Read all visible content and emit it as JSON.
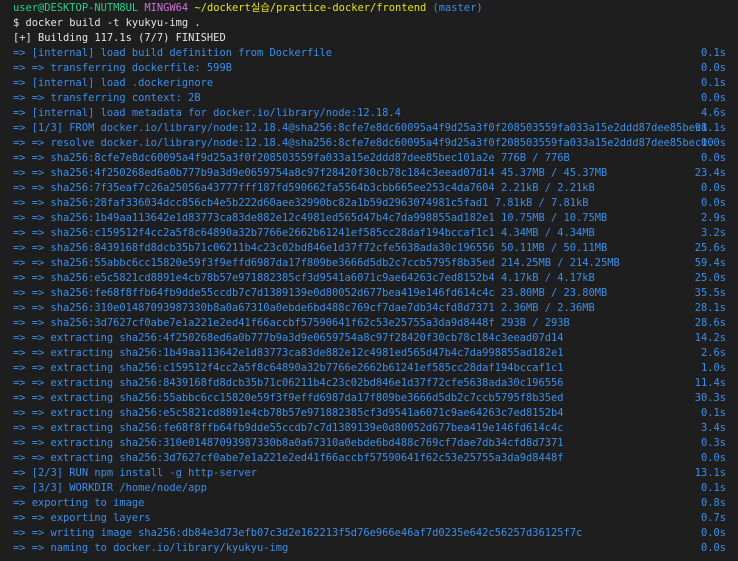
{
  "prompt": {
    "user_host": "user@DESKTOP-NUTM8UL",
    "shell": "MINGW64",
    "path": "~/dockert실습/practice-docker/frontend",
    "branch": "(master)"
  },
  "command": "$ docker build -t kyukyu-img .",
  "status": "[+] Building 117.1s (7/7) FINISHED",
  "steps": [
    {
      "text": "=> [internal] load build definition from Dockerfile",
      "time": "0.1s"
    },
    {
      "text": "=> => transferring dockerfile: 599B",
      "time": "0.0s"
    },
    {
      "text": "=> [internal] load .dockerignore",
      "time": "0.1s"
    },
    {
      "text": "=> => transferring context: 2B",
      "time": "0.0s"
    },
    {
      "text": "=> [internal] load metadata for docker.io/library/node:12.18.4",
      "time": "4.6s"
    },
    {
      "text": "=> [1/3] FROM docker.io/library/node:12.18.4@sha256:8cfe7e8dc60095a4f9d25a3f0f208503559fa033a15e2ddd87dee85bec1",
      "time": "98.1s"
    },
    {
      "text": "=> => resolve docker.io/library/node:12.18.4@sha256:8cfe7e8dc60095a4f9d25a3f0f208503559fa033a15e2ddd87dee85bec10",
      "time": "0.0s"
    },
    {
      "text": "=> => sha256:8cfe7e8dc60095a4f9d25a3f0f208503559fa033a15e2ddd87dee85bec101a2e 776B / 776B",
      "time": "0.0s"
    },
    {
      "text": "=> => sha256:4f250268ed6a0b777b9a3d9e0659754a8c97f28420f30cb78c184c3eead07d14 45.37MB / 45.37MB",
      "time": "23.4s"
    },
    {
      "text": "=> => sha256:7f35eaf7c26a25056a43777fff187fd590662fa5564b3cbb665ee253c4da7604 2.21kB / 2.21kB",
      "time": "0.0s"
    },
    {
      "text": "=> => sha256:28faf336034dcc856cb4e5b222d60aee32990bc82a1b59d2963074981c5fad1 7.81kB / 7.81kB",
      "time": "0.0s"
    },
    {
      "text": "=> => sha256:1b49aa113642e1d83773ca83de882e12c4981ed565d47b4c7da998855ad182e1 10.75MB / 10.75MB",
      "time": "2.9s"
    },
    {
      "text": "=> => sha256:c159512f4cc2a5f8c64890a32b7766e2662b61241ef585cc28daf194bccaf1c1 4.34MB / 4.34MB",
      "time": "3.2s"
    },
    {
      "text": "=> => sha256:8439168fd8dcb35b71c06211b4c23c02bd846e1d37f72cfe5638ada30c196556 50.11MB / 50.11MB",
      "time": "25.6s"
    },
    {
      "text": "=> => sha256:55abbc6cc15820e59f3f9effd6987da17f809be3666d5db2c7ccb5795f8b35ed 214.25MB / 214.25MB",
      "time": "59.4s"
    },
    {
      "text": "=> => sha256:e5c5821cd8891e4cb78b57e971882385cf3d9541a6071c9ae64263c7ed8152b4 4.17kB / 4.17kB",
      "time": "25.0s"
    },
    {
      "text": "=> => sha256:fe68f8ffb64fb9dde55ccdb7c7d1389139e0d80052d677bea419e146fd614c4c 23.80MB / 23.80MB",
      "time": "35.5s"
    },
    {
      "text": "=> => sha256:310e01487093987330b8a0a67310a0ebde6bd488c769cf7dae7db34cfd8d7371 2.36MB / 2.36MB",
      "time": "28.1s"
    },
    {
      "text": "=> => sha256:3d7627cf0abe7e1a221e2ed41f66accbf57590641f62c53e25755a3da9d8448f 293B / 293B",
      "time": "28.6s"
    },
    {
      "text": "=> => extracting sha256:4f250268ed6a0b777b9a3d9e0659754a8c97f28420f30cb78c184c3eead07d14",
      "time": "14.2s"
    },
    {
      "text": "=> => extracting sha256:1b49aa113642e1d83773ca83de882e12c4981ed565d47b4c7da998855ad182e1",
      "time": "2.6s"
    },
    {
      "text": "=> => extracting sha256:c159512f4cc2a5f8c64890a32b7766e2662b61241ef585cc28daf194bccaf1c1",
      "time": "1.0s"
    },
    {
      "text": "=> => extracting sha256:8439168fd8dcb35b71c06211b4c23c02bd846e1d37f72cfe5638ada30c196556",
      "time": "11.4s"
    },
    {
      "text": "=> => extracting sha256:55abbc6cc15820e59f3f9effd6987da17f809be3666d5db2c7ccb5795f8b35ed",
      "time": "30.3s"
    },
    {
      "text": "=> => extracting sha256:e5c5821cd8891e4cb78b57e971882385cf3d9541a6071c9ae64263c7ed8152b4",
      "time": "0.1s"
    },
    {
      "text": "=> => extracting sha256:fe68f8ffb64fb9dde55ccdb7c7d1389139e0d80052d677bea419e146fd614c4c",
      "time": "3.4s"
    },
    {
      "text": "=> => extracting sha256:310e01487093987330b8a0a67310a0ebde6bd488c769cf7dae7db34cfd8d7371",
      "time": "0.3s"
    },
    {
      "text": "=> => extracting sha256:3d7627cf0abe7e1a221e2ed41f66accbf57590641f62c53e25755a3da9d8448f",
      "time": "0.0s"
    },
    {
      "text": "=> [2/3] RUN npm install -g http-server",
      "time": "13.1s"
    },
    {
      "text": "=> [3/3] WORKDIR /home/node/app",
      "time": "0.1s"
    },
    {
      "text": "=> exporting to image",
      "time": "0.8s"
    },
    {
      "text": "=> => exporting layers",
      "time": "0.7s"
    },
    {
      "text": "=> => writing image sha256:db84e3d73efb07c3d2e162213f5d76e966e46af7d0235e642c56257d36125f7c",
      "time": "0.0s"
    },
    {
      "text": "=> => naming to docker.io/library/kyukyu-img",
      "time": "0.0s"
    }
  ]
}
